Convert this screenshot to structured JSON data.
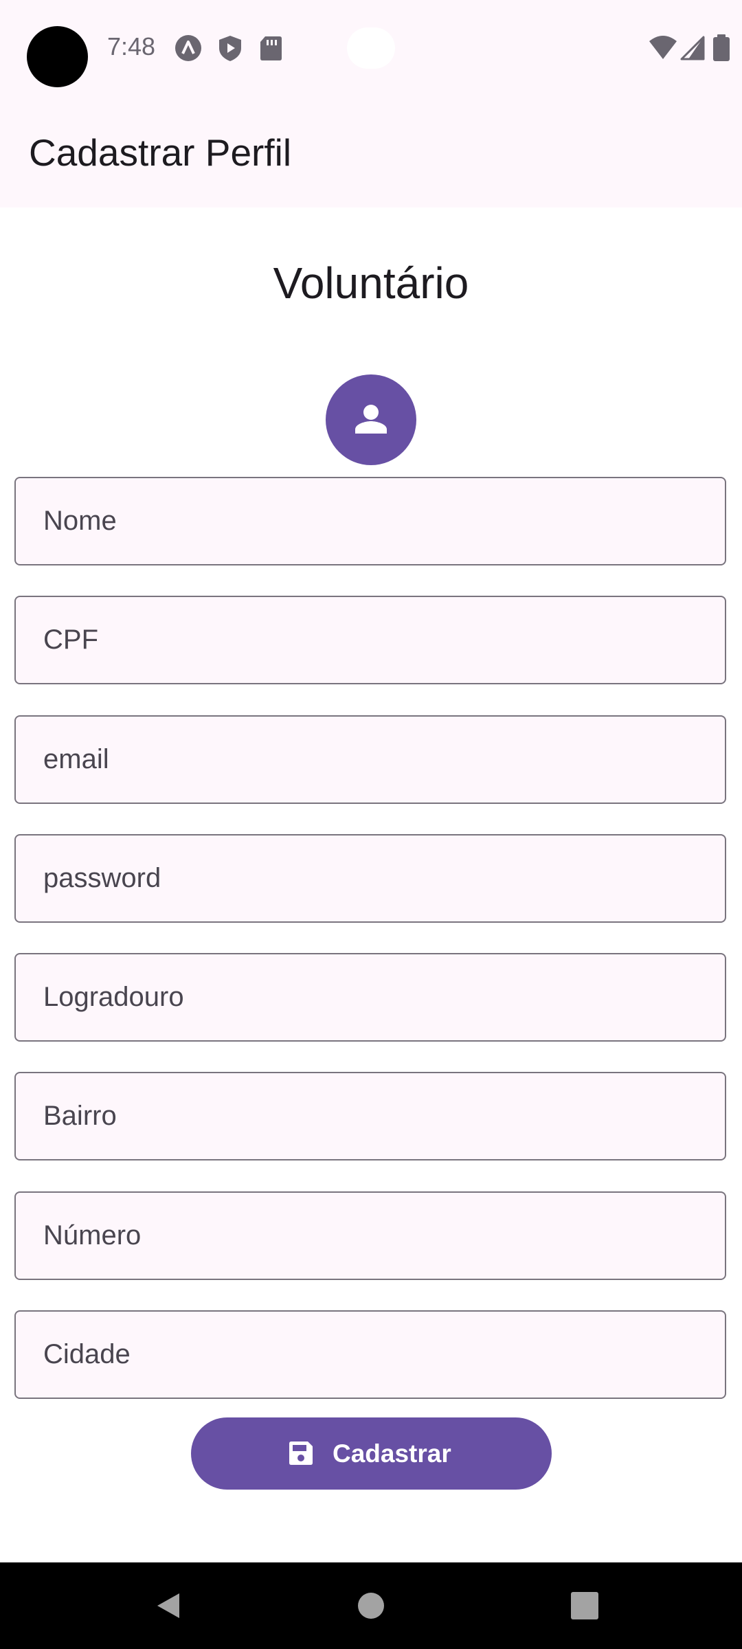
{
  "status_bar": {
    "time": "7:48",
    "icons": [
      "launcher-icon",
      "shield-play-icon",
      "sd-card-icon",
      "wifi-icon",
      "signal-icon",
      "battery-icon"
    ]
  },
  "app_bar": {
    "title": "Cadastrar Perfil"
  },
  "form": {
    "section_title": "Voluntário",
    "avatar_icon": "person-icon",
    "fields": [
      {
        "placeholder": "Nome",
        "value": ""
      },
      {
        "placeholder": "CPF",
        "value": ""
      },
      {
        "placeholder": "email",
        "value": ""
      },
      {
        "placeholder": "password",
        "value": ""
      },
      {
        "placeholder": "Logradouro",
        "value": ""
      },
      {
        "placeholder": "Bairro",
        "value": ""
      },
      {
        "placeholder": "Número",
        "value": ""
      },
      {
        "placeholder": "Cidade",
        "value": ""
      }
    ],
    "submit": {
      "label": "Cadastrar",
      "icon": "save-icon"
    }
  },
  "nav_bar": {
    "buttons": [
      "back-icon",
      "home-icon",
      "recents-icon"
    ]
  },
  "colors": {
    "primary": "#6750a4",
    "surface": "#fef7fc",
    "outline": "#79747e"
  }
}
